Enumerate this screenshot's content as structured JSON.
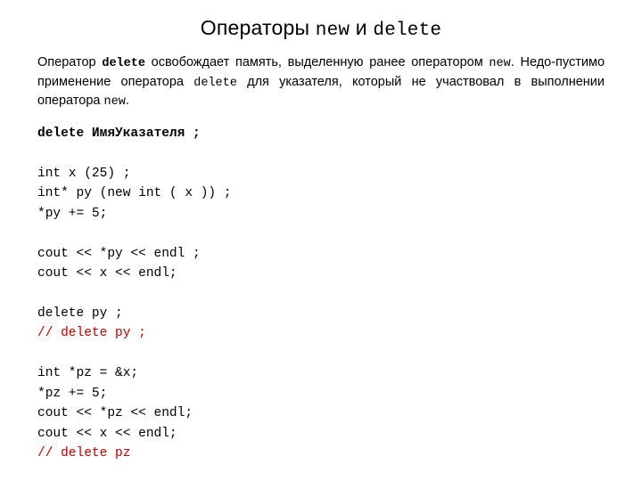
{
  "title": {
    "pre": "Операторы ",
    "kw1": "new",
    "mid": " и ",
    "kw2": "delete"
  },
  "para": {
    "t0": "Оператор ",
    "kw_delete": "delete",
    "t1": " освобождает память, выделенную ранее оператором ",
    "kw_new1": "new",
    "t2": ". Недо-пустимо применение оператора ",
    "kw_delete2": "delete",
    "t3": " для указателя, который не участвовал в выполнении оператора ",
    "kw_new2": "new",
    "t4": "."
  },
  "code": {
    "l1": "delete ИмяУказателя ;",
    "l2": "",
    "l3": "int x (25) ;",
    "l4": "int* py (new int ( x )) ;",
    "l5": "*py += 5;",
    "l6": "",
    "l7": "cout << *py << endl ;",
    "l8": "cout << x << endl;",
    "l9": "",
    "l10": "delete py ;",
    "l11": "// delete py ;",
    "l12": "",
    "l13": "int *pz = &x;",
    "l14": "*pz += 5;",
    "l15": "cout << *pz << endl;",
    "l16": "cout << x << endl;",
    "l17": "// delete pz"
  }
}
